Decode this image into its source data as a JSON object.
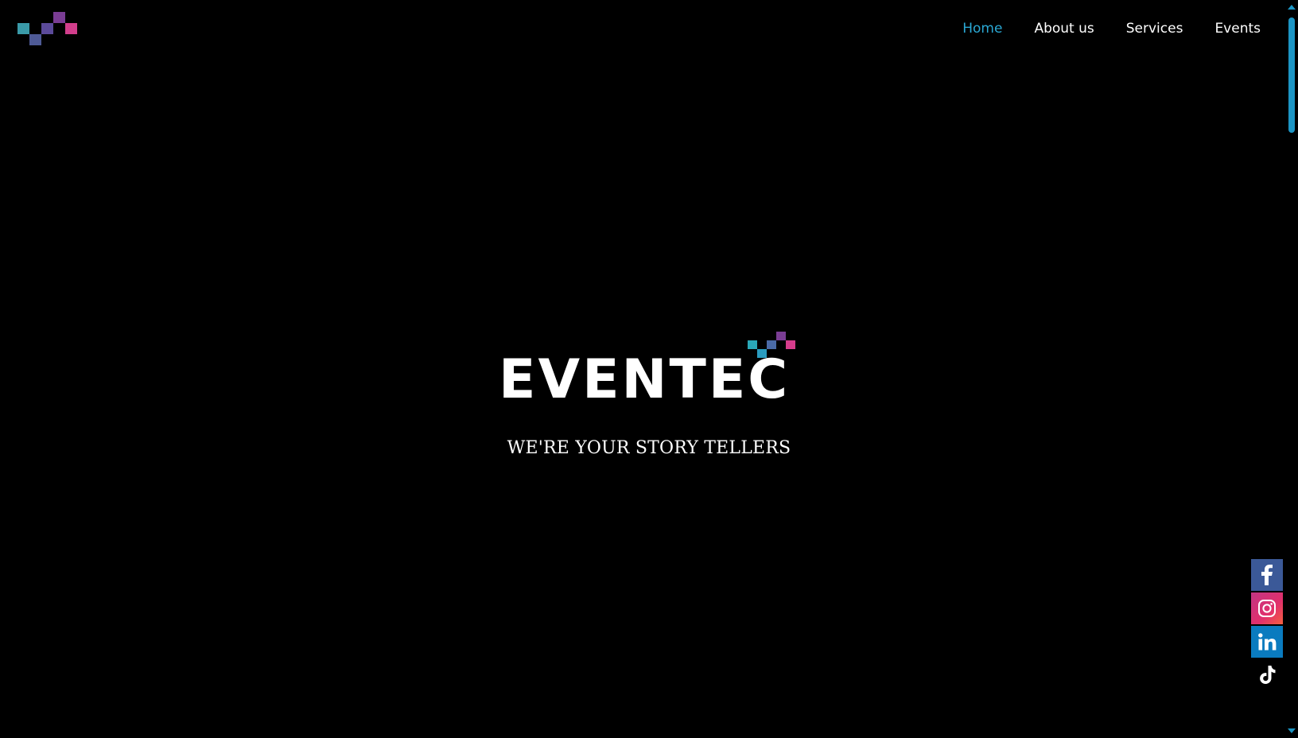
{
  "header": {
    "logo_icon": "pixel-steps-logo-icon",
    "nav": [
      {
        "label": "Home",
        "active": true
      },
      {
        "label": "About us",
        "active": false
      },
      {
        "label": "Services",
        "active": false
      },
      {
        "label": "Events",
        "active": false
      }
    ]
  },
  "hero": {
    "brand_name": "EVENTEC",
    "tagline": "WE'RE YOUR STORY TELLERS"
  },
  "social": [
    {
      "name": "facebook",
      "icon": "facebook-icon",
      "color": "#3b5998"
    },
    {
      "name": "instagram",
      "icon": "instagram-icon",
      "color": "#d6336c"
    },
    {
      "name": "linkedin",
      "icon": "linkedin-icon",
      "color": "#0a7bbf"
    },
    {
      "name": "tiktok",
      "icon": "tiktok-icon",
      "color": "#000000"
    }
  ],
  "colors": {
    "background": "#000000",
    "accent": "#2aa8d4",
    "text": "#ffffff",
    "logo_teal": "#2aa8b8",
    "logo_purple": "#6a3d8f",
    "logo_pink": "#d63c8c"
  }
}
